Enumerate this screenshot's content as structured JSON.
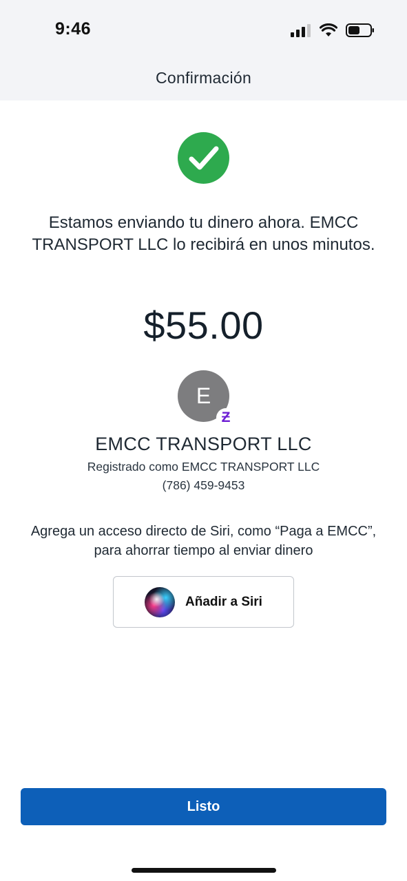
{
  "status_bar": {
    "time": "9:46"
  },
  "nav": {
    "title": "Confirmación"
  },
  "confirmation": {
    "message": "Estamos enviando tu dinero ahora. EMCC TRANSPORT LLC lo recibirá en unos minutos.",
    "amount": "$55.00"
  },
  "recipient": {
    "avatar_initial": "E",
    "badge_symbol": "Ƶ",
    "name": "EMCC TRANSPORT LLC",
    "registered_as": "Registrado como EMCC TRANSPORT LLC",
    "phone": "(786) 459-9453"
  },
  "siri": {
    "hint": "Agrega un acceso directo de Siri, como “Paga a EMCC”, para ahorrar tiempo al enviar dinero",
    "button_label": "Añadir a Siri"
  },
  "footer": {
    "done_label": "Listo"
  },
  "colors": {
    "success_green": "#2eaa4e",
    "primary_blue": "#0d5fb8",
    "zelle_purple": "#6d1ed4",
    "avatar_gray": "#7d7d7f"
  },
  "icons": [
    "cellular-signal-icon",
    "wifi-icon",
    "battery-icon",
    "checkmark-icon",
    "zelle-icon",
    "siri-icon"
  ]
}
